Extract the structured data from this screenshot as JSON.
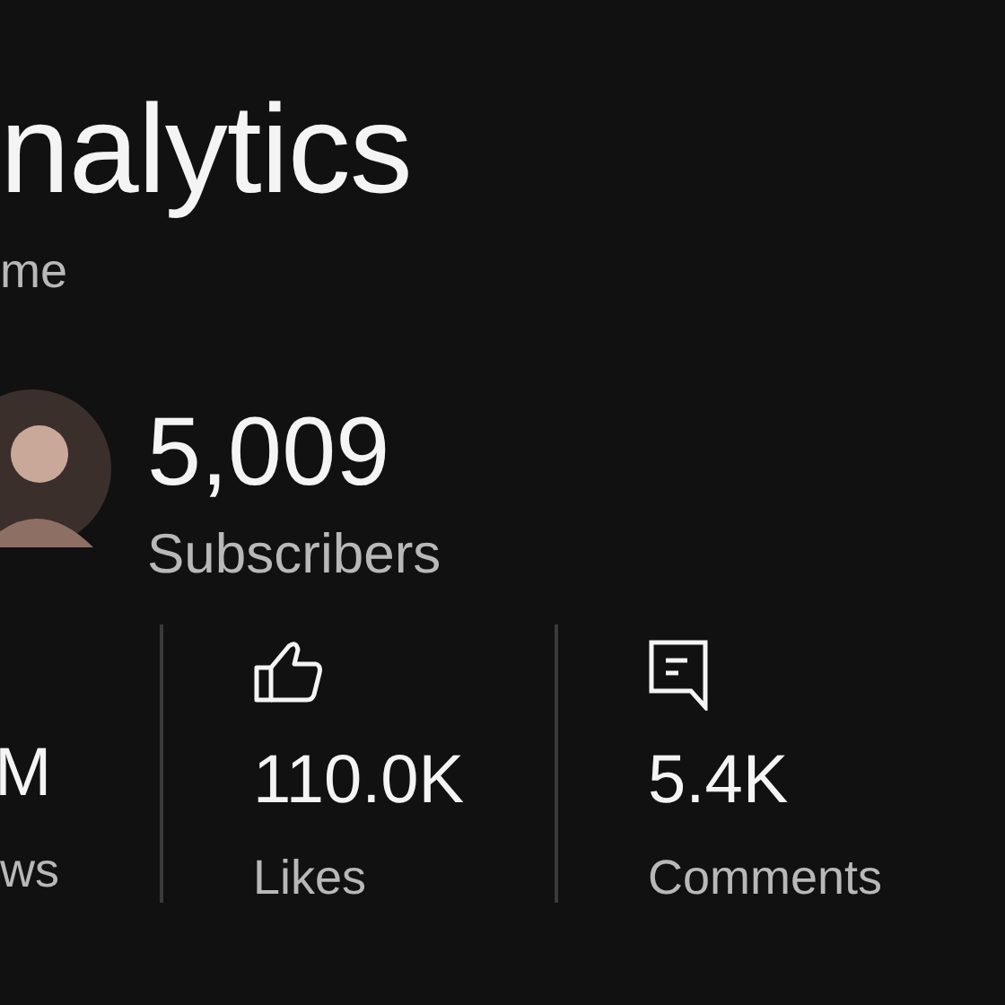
{
  "header": {
    "title": "nalytics",
    "subtitle": "me"
  },
  "channel": {
    "subscriber_count": "5,009",
    "subscriber_label": "Subscribers"
  },
  "stats": [
    {
      "kind": "views",
      "value": "M",
      "label": "ws"
    },
    {
      "kind": "likes",
      "value": "110.0K",
      "label": "Likes"
    },
    {
      "kind": "comments",
      "value": "5.4K",
      "label": "Comments"
    }
  ]
}
